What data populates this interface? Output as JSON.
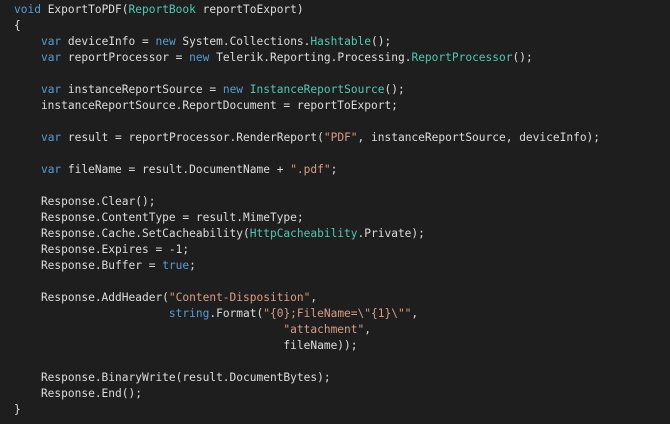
{
  "colors": {
    "background": "#1e1e1e",
    "plain": "#dcdcdc",
    "keyword": "#569cd6",
    "type": "#4ec9b0",
    "string": "#d69d85"
  },
  "code_lines": [
    [
      {
        "t": "kw",
        "v": "void"
      },
      {
        "t": "plain",
        "v": " ExportToPDF("
      },
      {
        "t": "type",
        "v": "ReportBook"
      },
      {
        "t": "plain",
        "v": " reportToExport)"
      }
    ],
    [
      {
        "t": "plain",
        "v": "{"
      }
    ],
    [
      {
        "t": "plain",
        "v": "    "
      },
      {
        "t": "kw",
        "v": "var"
      },
      {
        "t": "plain",
        "v": " deviceInfo = "
      },
      {
        "t": "kw",
        "v": "new"
      },
      {
        "t": "plain",
        "v": " System.Collections."
      },
      {
        "t": "type",
        "v": "Hashtable"
      },
      {
        "t": "plain",
        "v": "();"
      }
    ],
    [
      {
        "t": "plain",
        "v": "    "
      },
      {
        "t": "kw",
        "v": "var"
      },
      {
        "t": "plain",
        "v": " reportProcessor = "
      },
      {
        "t": "kw",
        "v": "new"
      },
      {
        "t": "plain",
        "v": " Telerik.Reporting.Processing."
      },
      {
        "t": "type",
        "v": "ReportProcessor"
      },
      {
        "t": "plain",
        "v": "();"
      }
    ],
    [],
    [
      {
        "t": "plain",
        "v": "    "
      },
      {
        "t": "kw",
        "v": "var"
      },
      {
        "t": "plain",
        "v": " instanceReportSource = "
      },
      {
        "t": "kw",
        "v": "new"
      },
      {
        "t": "plain",
        "v": " "
      },
      {
        "t": "type",
        "v": "InstanceReportSource"
      },
      {
        "t": "plain",
        "v": "();"
      }
    ],
    [
      {
        "t": "plain",
        "v": "    instanceReportSource.ReportDocument = reportToExport;"
      }
    ],
    [],
    [
      {
        "t": "plain",
        "v": "    "
      },
      {
        "t": "kw",
        "v": "var"
      },
      {
        "t": "plain",
        "v": " result = reportProcessor.RenderReport("
      },
      {
        "t": "str",
        "v": "\"PDF\""
      },
      {
        "t": "plain",
        "v": ", instanceReportSource, deviceInfo);"
      }
    ],
    [],
    [
      {
        "t": "plain",
        "v": "    "
      },
      {
        "t": "kw",
        "v": "var"
      },
      {
        "t": "plain",
        "v": " fileName = result.DocumentName + "
      },
      {
        "t": "str",
        "v": "\".pdf\""
      },
      {
        "t": "plain",
        "v": ";"
      }
    ],
    [],
    [
      {
        "t": "plain",
        "v": "    Response.Clear();"
      }
    ],
    [
      {
        "t": "plain",
        "v": "    Response.ContentType = result.MimeType;"
      }
    ],
    [
      {
        "t": "plain",
        "v": "    Response.Cache.SetCacheability("
      },
      {
        "t": "type",
        "v": "HttpCacheability"
      },
      {
        "t": "plain",
        "v": ".Private);"
      }
    ],
    [
      {
        "t": "plain",
        "v": "    Response.Expires = -1;"
      }
    ],
    [
      {
        "t": "plain",
        "v": "    Response.Buffer = "
      },
      {
        "t": "kw",
        "v": "true"
      },
      {
        "t": "plain",
        "v": ";"
      }
    ],
    [],
    [
      {
        "t": "plain",
        "v": "    Response.AddHeader("
      },
      {
        "t": "str",
        "v": "\"Content-Disposition\""
      },
      {
        "t": "plain",
        "v": ","
      }
    ],
    [
      {
        "t": "plain",
        "v": "                       "
      },
      {
        "t": "kw",
        "v": "string"
      },
      {
        "t": "plain",
        "v": ".Format("
      },
      {
        "t": "str",
        "v": "\"{0};FileName=\\\"{1}\\\"\""
      },
      {
        "t": "plain",
        "v": ","
      }
    ],
    [
      {
        "t": "plain",
        "v": "                                        "
      },
      {
        "t": "str",
        "v": "\"attachment\""
      },
      {
        "t": "plain",
        "v": ","
      }
    ],
    [
      {
        "t": "plain",
        "v": "                                        fileName));"
      }
    ],
    [],
    [
      {
        "t": "plain",
        "v": "    Response.BinaryWrite(result.DocumentBytes);"
      }
    ],
    [
      {
        "t": "plain",
        "v": "    Response.End();"
      }
    ],
    [
      {
        "t": "plain",
        "v": "}"
      }
    ]
  ]
}
